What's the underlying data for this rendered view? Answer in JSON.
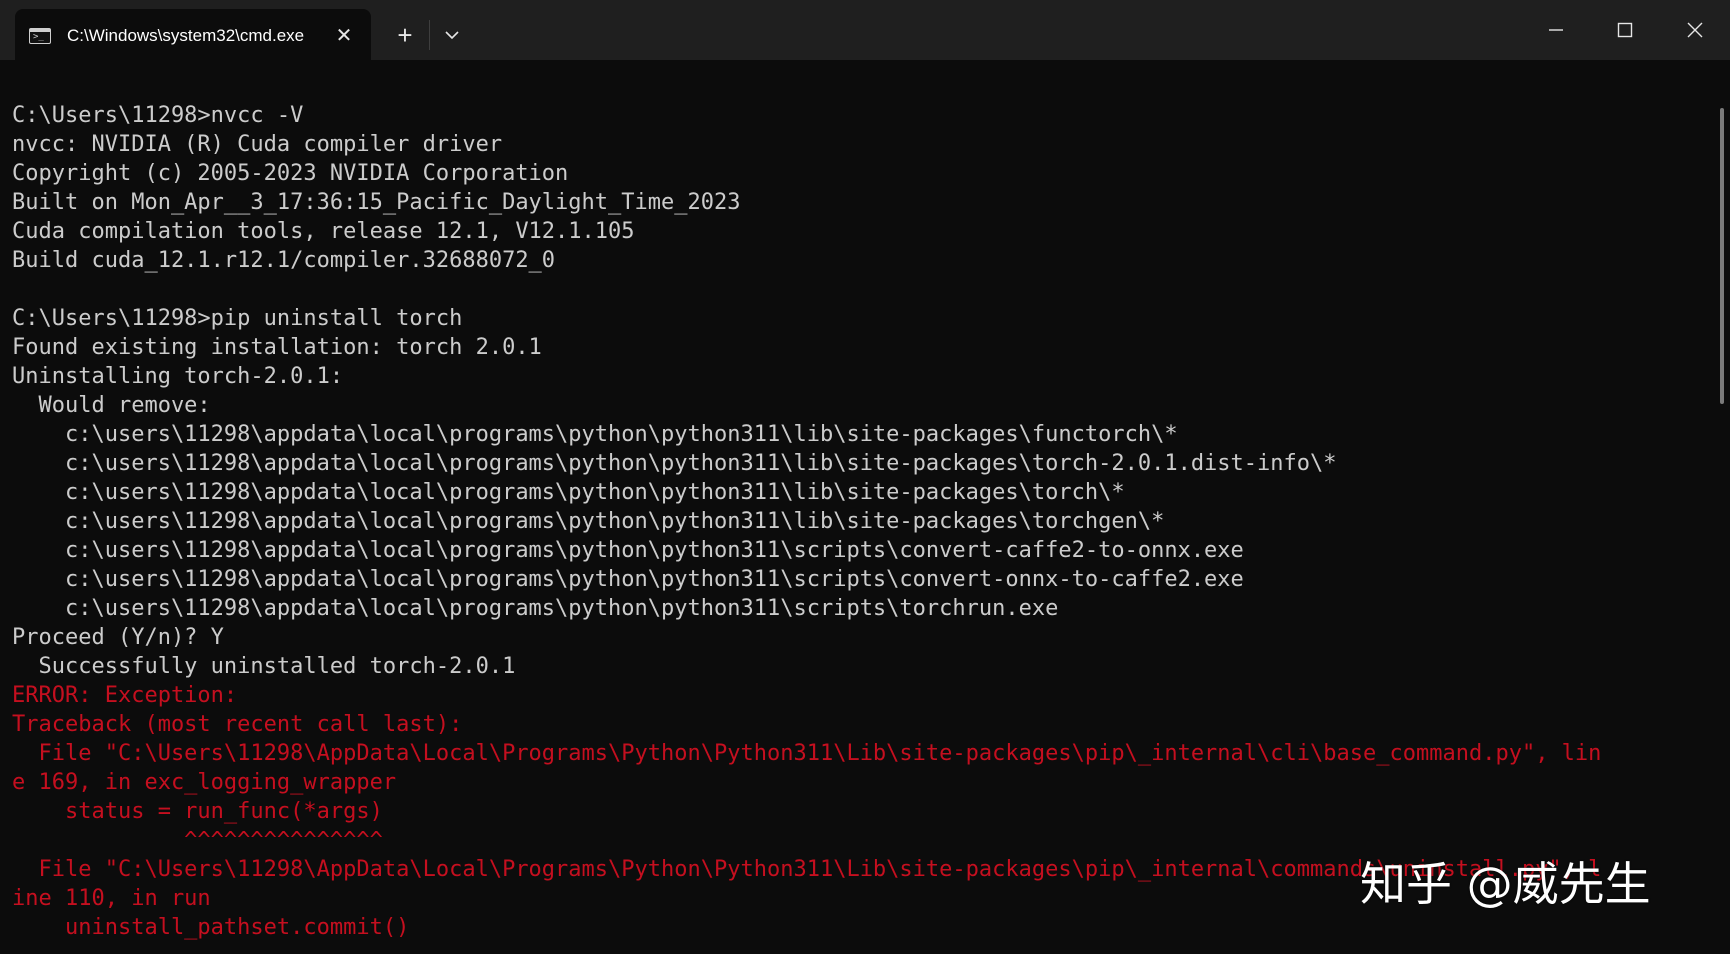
{
  "window": {
    "tab_title": "C:\\Windows\\system32\\cmd.exe",
    "tab_icon_glyph": ">_",
    "close_tab_glyph": "✕",
    "new_tab_glyph": "+"
  },
  "terminal": {
    "lines": [
      {
        "text": "",
        "style": "normal"
      },
      {
        "text": "C:\\Users\\11298>nvcc -V",
        "style": "normal"
      },
      {
        "text": "nvcc: NVIDIA (R) Cuda compiler driver",
        "style": "normal"
      },
      {
        "text": "Copyright (c) 2005-2023 NVIDIA Corporation",
        "style": "normal"
      },
      {
        "text": "Built on Mon_Apr__3_17:36:15_Pacific_Daylight_Time_2023",
        "style": "normal"
      },
      {
        "text": "Cuda compilation tools, release 12.1, V12.1.105",
        "style": "normal"
      },
      {
        "text": "Build cuda_12.1.r12.1/compiler.32688072_0",
        "style": "normal"
      },
      {
        "text": "",
        "style": "normal"
      },
      {
        "text": "C:\\Users\\11298>pip uninstall torch",
        "style": "normal"
      },
      {
        "text": "Found existing installation: torch 2.0.1",
        "style": "normal"
      },
      {
        "text": "Uninstalling torch-2.0.1:",
        "style": "normal"
      },
      {
        "text": "  Would remove:",
        "style": "normal"
      },
      {
        "text": "    c:\\users\\11298\\appdata\\local\\programs\\python\\python311\\lib\\site-packages\\functorch\\*",
        "style": "normal"
      },
      {
        "text": "    c:\\users\\11298\\appdata\\local\\programs\\python\\python311\\lib\\site-packages\\torch-2.0.1.dist-info\\*",
        "style": "normal"
      },
      {
        "text": "    c:\\users\\11298\\appdata\\local\\programs\\python\\python311\\lib\\site-packages\\torch\\*",
        "style": "normal"
      },
      {
        "text": "    c:\\users\\11298\\appdata\\local\\programs\\python\\python311\\lib\\site-packages\\torchgen\\*",
        "style": "normal"
      },
      {
        "text": "    c:\\users\\11298\\appdata\\local\\programs\\python\\python311\\scripts\\convert-caffe2-to-onnx.exe",
        "style": "normal"
      },
      {
        "text": "    c:\\users\\11298\\appdata\\local\\programs\\python\\python311\\scripts\\convert-onnx-to-caffe2.exe",
        "style": "normal"
      },
      {
        "text": "    c:\\users\\11298\\appdata\\local\\programs\\python\\python311\\scripts\\torchrun.exe",
        "style": "normal"
      },
      {
        "text": "Proceed (Y/n)? Y",
        "style": "normal"
      },
      {
        "text": "  Successfully uninstalled torch-2.0.1",
        "style": "normal"
      },
      {
        "text": "ERROR: Exception:",
        "style": "error"
      },
      {
        "text": "Traceback (most recent call last):",
        "style": "error"
      },
      {
        "text": "  File \"C:\\Users\\11298\\AppData\\Local\\Programs\\Python\\Python311\\Lib\\site-packages\\pip\\_internal\\cli\\base_command.py\", lin",
        "style": "error"
      },
      {
        "text": "e 169, in exc_logging_wrapper",
        "style": "error"
      },
      {
        "text": "    status = run_func(*args)",
        "style": "error"
      },
      {
        "text": "             ^^^^^^^^^^^^^^^",
        "style": "error"
      },
      {
        "text": "  File \"C:\\Users\\11298\\AppData\\Local\\Programs\\Python\\Python311\\Lib\\site-packages\\pip\\_internal\\commands\\uninstall.py\", l",
        "style": "error"
      },
      {
        "text": "ine 110, in run",
        "style": "error"
      },
      {
        "text": "    uninstall_pathset.commit()",
        "style": "error"
      }
    ]
  },
  "watermark": "知乎 @威先生",
  "colors": {
    "background": "#0c0c0c",
    "titlebar": "#1f1f1f",
    "text": "#cccccc",
    "error": "#c50f1f"
  }
}
